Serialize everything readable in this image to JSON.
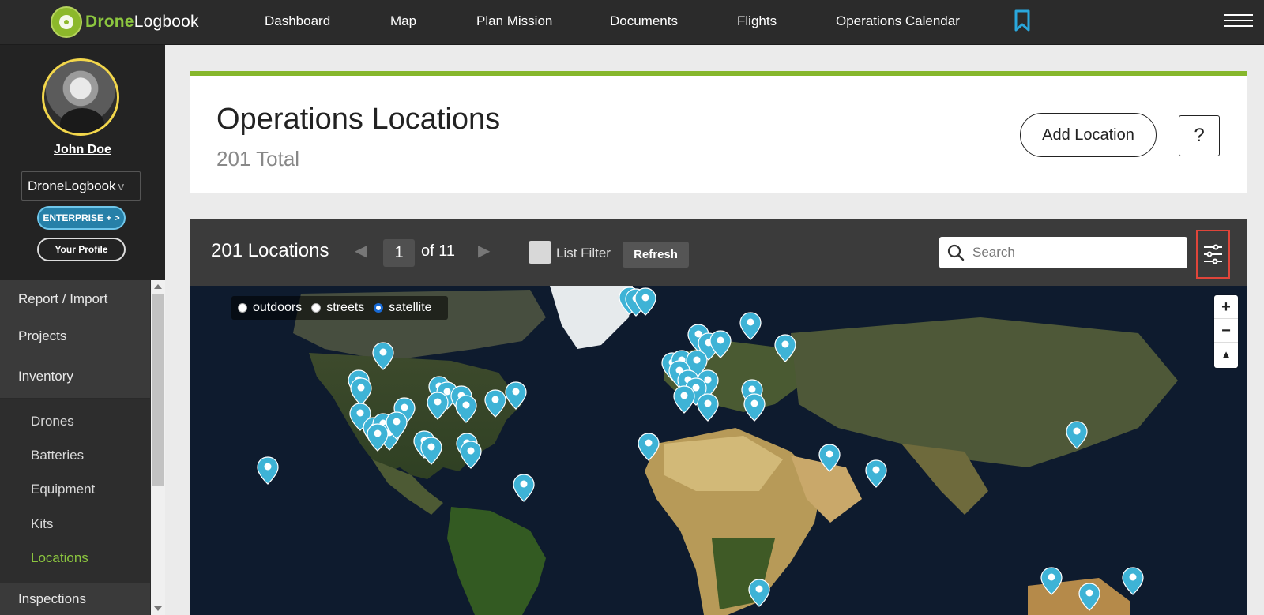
{
  "app": {
    "logo_accent": "Drone",
    "logo_rest": "Logbook"
  },
  "topnav": {
    "items": [
      "Dashboard",
      "Map",
      "Plan Mission",
      "Documents",
      "Flights",
      "Operations Calendar"
    ]
  },
  "sidebar": {
    "user_name": "John Doe",
    "org": "DroneLogbook",
    "enterprise_label": "ENTERPRISE + >",
    "profile_label": "Your Profile",
    "menu": [
      "Report / Import",
      "Projects",
      "Inventory"
    ],
    "submenu": [
      "Drones",
      "Batteries",
      "Equipment",
      "Kits",
      "Locations"
    ],
    "active_submenu": "Locations",
    "menu_bottom": "Inspections"
  },
  "header": {
    "title": "Operations Locations",
    "total": "201 Total",
    "add_label": "Add Location",
    "help_label": "?"
  },
  "toolbar": {
    "count_label": "201 Locations",
    "page_value": "1",
    "page_of": "of 11",
    "list_filter_label": "List Filter",
    "refresh_label": "Refresh",
    "search_placeholder": "Search"
  },
  "map": {
    "styles": [
      "outdoors",
      "streets",
      "satellite"
    ],
    "selected_style": "satellite",
    "marker_color": "#3eb3d6"
  },
  "colors": {
    "brand_green": "#86b72c",
    "accent_blue": "#2680a8",
    "highlight_red": "#e0453a"
  }
}
